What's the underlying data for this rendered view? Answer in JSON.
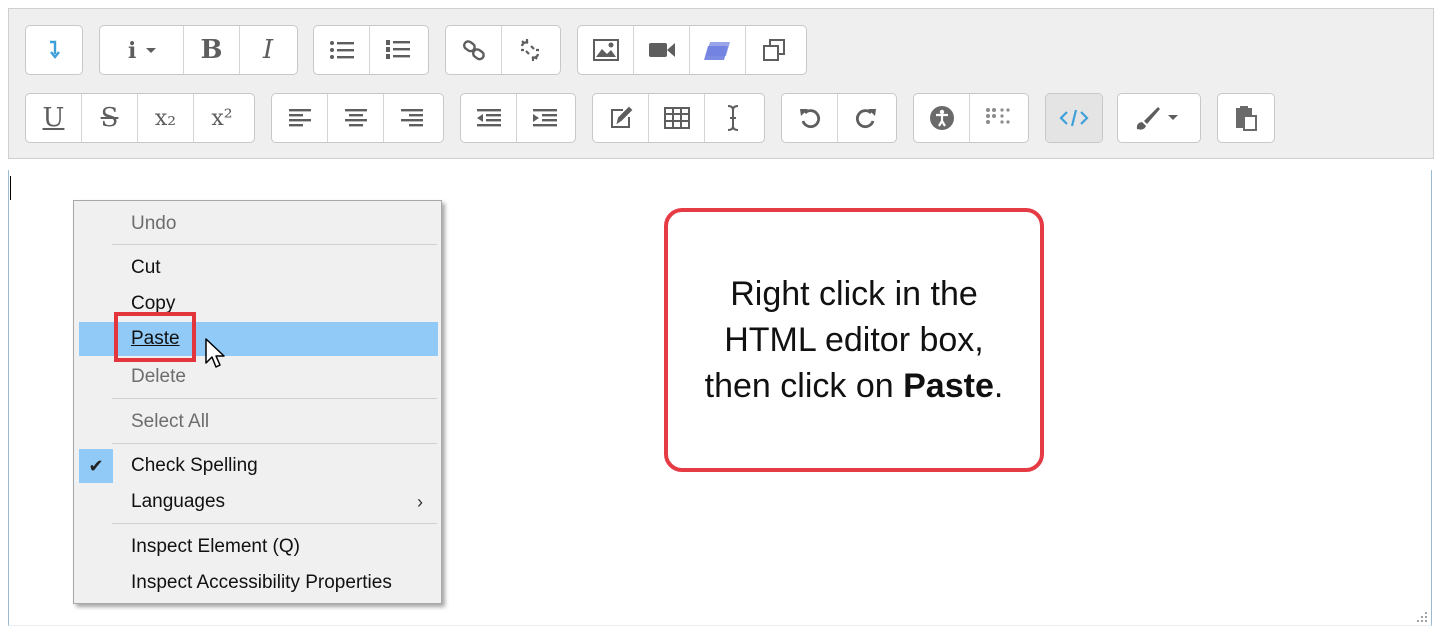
{
  "context_menu": {
    "undo": "Undo",
    "cut": "Cut",
    "copy": "Copy",
    "paste": "Paste",
    "delete": "Delete",
    "select_all": "Select All",
    "check_spelling": "Check Spelling",
    "check_spelling_checked": true,
    "languages": "Languages",
    "languages_arrow": "›",
    "inspect_element": "Inspect Element (Q)",
    "inspect_accessibility": "Inspect Accessibility Properties"
  },
  "callout": {
    "line1": "Right click in the",
    "line2": "HTML editor box,",
    "line3_prefix": "then click on ",
    "line3_bold": "Paste",
    "line3_suffix": "."
  },
  "toolbar": {
    "row1": [
      "collapse-icon",
      "info-icon",
      "bold-icon",
      "italic-icon",
      "bullet-list-icon",
      "numbered-list-icon",
      "link-icon",
      "unlink-icon",
      "image-icon",
      "video-icon",
      "manage-files-icon",
      "recordrtc-icon"
    ],
    "row2": [
      "underline-icon",
      "strikethrough-icon",
      "subscript-icon",
      "superscript-icon",
      "align-left-icon",
      "align-center-icon",
      "align-right-icon",
      "outdent-icon",
      "indent-icon",
      "equation-icon",
      "table-icon",
      "clear-formatting-icon",
      "undo-icon",
      "redo-icon",
      "accessibility-checker-icon",
      "screenreader-helper-icon",
      "html-icon",
      "font-color-icon",
      "paste-special-icon"
    ],
    "bold_label": "B",
    "italic_label": "I",
    "underline_label": "U",
    "strike_label": "S",
    "subscript_label": "x₂",
    "superscript_label": "x²",
    "accent_color": "#3ea0d8",
    "highlight_color": "#91c9f7",
    "annotation_color": "#e2363c"
  }
}
